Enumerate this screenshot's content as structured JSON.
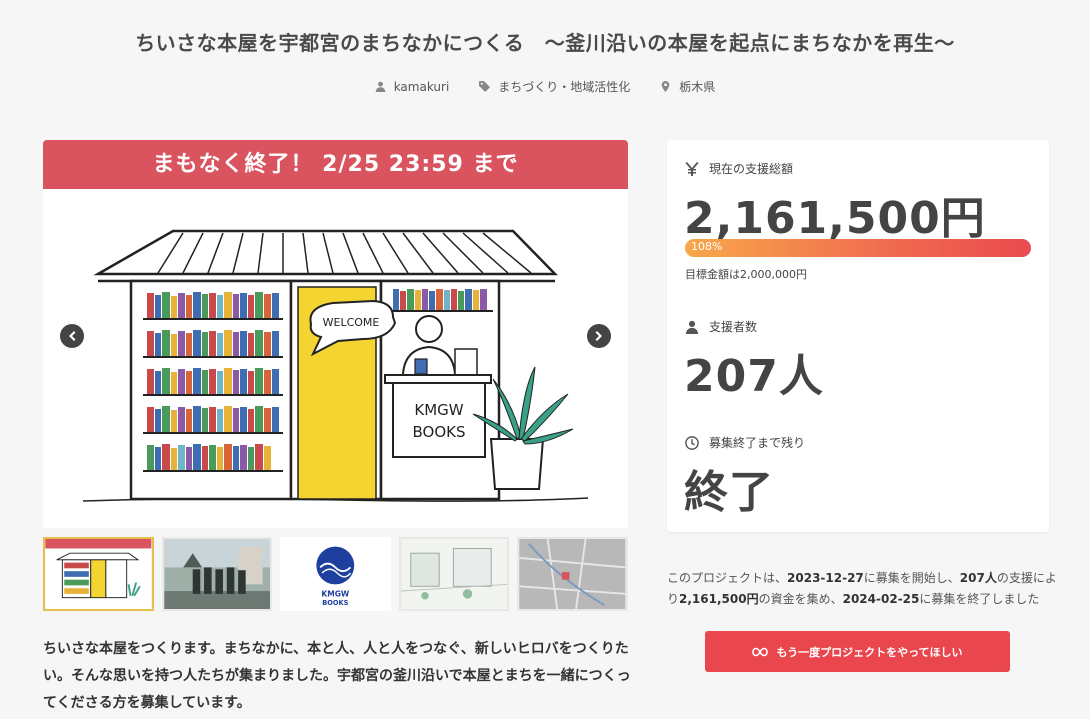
{
  "project": {
    "title": "ちいさな本屋を宇都宮のまちなかにつくる　〜釜川沿いの本屋を起点にまちなかを再生〜",
    "author": "kamakuri",
    "category": "まちづくり・地域活性化",
    "location": "栃木県"
  },
  "hero": {
    "banner": "まもなく終了！ 2/25 23:59 まで",
    "sign_welcome": "WELCOME",
    "sign_books_1": "KMGW",
    "sign_books_2": "BOOKS"
  },
  "thumbnails": [
    {
      "name": "shop-illustration",
      "active": true
    },
    {
      "name": "team-photo",
      "active": false
    },
    {
      "name": "kmgw-books-logo",
      "active": false,
      "logo_text": "KMGW",
      "logo_sub": "BOOKS"
    },
    {
      "name": "street-illustration",
      "active": false
    },
    {
      "name": "map-image",
      "active": false
    }
  ],
  "description": "ちいさな本屋をつくります。まちなかに、本と人、人と人をつなぐ、新しいヒロバをつくりたい。そんな思いを持つ人たちが集まりました。宇都宮の釜川沿いで本屋とまちを一緒につくってくださる方を募集しています。",
  "stats": {
    "total_label": "現在の支援総額",
    "total_value": "2,161,500円",
    "progress_percent": "108%",
    "progress_fraction": 1.08,
    "goal_text": "目標金額は2,000,000円",
    "supporters_label": "支援者数",
    "supporters_value": "207人",
    "remaining_label": "募集終了まで残り",
    "remaining_value": "終了"
  },
  "summary": {
    "p1": "このプロジェクトは、",
    "start": "2023-12-27",
    "p2": "に募集を開始し、",
    "count": "207人",
    "p3": "の支援により",
    "amount": "2,161,500円",
    "p4": "の資金を集め、",
    "end": "2024-02-25",
    "p5": "に募集を終了しました"
  },
  "cta": {
    "label": "もう一度プロジェクトをやってほしい"
  },
  "colors": {
    "accent": "#e9464e",
    "banner": "#d9545f",
    "highlight": "#e5c04a"
  }
}
